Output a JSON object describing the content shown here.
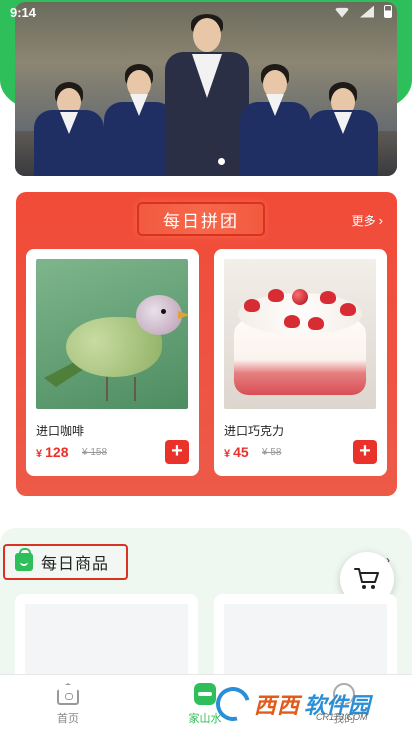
{
  "status_bar": {
    "time": "9:14"
  },
  "banner": {
    "current_index": 1,
    "total": 1
  },
  "group_buy": {
    "title": "每日拼团",
    "more_label": "更多",
    "products": [
      {
        "name": "进口咖啡",
        "currency": "¥",
        "price": "128",
        "original_price": "¥ 158",
        "image_desc": "bird"
      },
      {
        "name": "进口巧克力",
        "currency": "¥",
        "price": "45",
        "original_price": "¥ 58",
        "image_desc": "cake"
      }
    ]
  },
  "daily_goods": {
    "title": "每日商品"
  },
  "tab_bar": {
    "items": [
      {
        "label": "首页",
        "icon": "home-icon"
      },
      {
        "label": "家山水",
        "icon": "family-icon"
      },
      {
        "label": "我的",
        "icon": "user-icon"
      }
    ],
    "active_index": 1
  },
  "watermark": {
    "brand": "西西",
    "sub": "软件园",
    "url": "CR173.COM"
  },
  "colors": {
    "brand_green": "#2fbf5a",
    "accent_red": "#e8322a",
    "card_red": "#f04b38"
  }
}
